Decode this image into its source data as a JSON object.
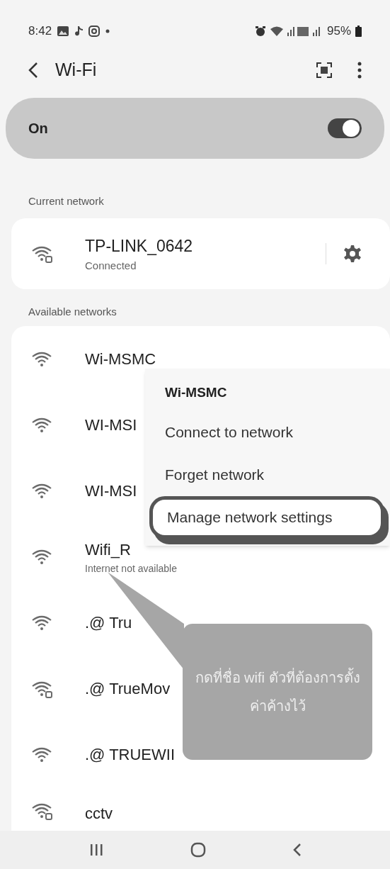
{
  "status_bar": {
    "time": "8:42",
    "battery": "95%"
  },
  "header": {
    "title": "Wi-Fi"
  },
  "master_switch": {
    "label": "On",
    "on": true
  },
  "current_section": {
    "title": "Current network"
  },
  "current_network": {
    "name": "TP-LINK_0642",
    "status": "Connected",
    "locked": true
  },
  "available_section": {
    "title": "Available networks"
  },
  "networks": [
    {
      "name": "Wi-MSMC",
      "locked": false
    },
    {
      "name": "WI-MSI",
      "locked": false
    },
    {
      "name": "WI-MSI",
      "locked": false
    },
    {
      "name": "Wifi_R",
      "status": "Internet not available",
      "locked": false
    },
    {
      "name": ".@ Tru",
      "locked": false
    },
    {
      "name": ".@ TrueMov",
      "locked": true
    },
    {
      "name": ".@ TRUEWII",
      "locked": false
    },
    {
      "name": "cctv",
      "locked": true
    }
  ],
  "context_menu": {
    "title": "Wi-MSMC",
    "items": [
      {
        "label": "Connect to network",
        "highlighted": false
      },
      {
        "label": "Forget network",
        "highlighted": false
      },
      {
        "label": "Manage network settings",
        "highlighted": true
      }
    ]
  },
  "callout": {
    "text": "กดที่ชื่อ wifi ตัวที่ต้องการตั้งค่าค้างไว้"
  }
}
